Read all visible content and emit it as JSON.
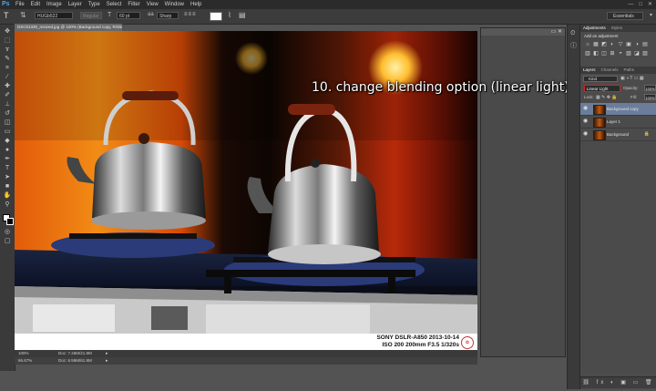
{
  "app": {
    "logo": "Ps",
    "menus": [
      "File",
      "Edit",
      "Image",
      "Layer",
      "Type",
      "Select",
      "Filter",
      "View",
      "Window",
      "Help"
    ],
    "window_controls": [
      "—",
      "□",
      "✕"
    ]
  },
  "options_bar": {
    "font_family": "HUGb522",
    "font_style": "Regular",
    "font_size": "60 pt",
    "antialias": "Sharp",
    "text_color": "#ffffff",
    "workspace": "Essentials"
  },
  "document": {
    "tab_title": "DSC01330_resized.jpg @ 100% (Background copy, RGB/16) *",
    "zoom_status": "100%",
    "doc_size": "Doc: 7.26M/21.8M",
    "bottom_zoom": "66.67%",
    "bottom_doc_size": "Doc: 6.59M/61.9M"
  },
  "photo_credit": {
    "line1": "SONY DSLR-A850 2013-10-14",
    "line2": "ISO 200 200mm F3.5 1/320s"
  },
  "annotation": "10. change blending option (linear light)",
  "adjustments_panel": {
    "tabs": [
      "Adjustments",
      "Styles"
    ],
    "add_label": "Add an adjustment",
    "icons": [
      "☼",
      "▦",
      "◩",
      "◐",
      "▽",
      "▣",
      "◑",
      "▤",
      "▥",
      "◧",
      "◫",
      "⊞",
      "◓",
      "▧",
      "◪",
      "▨"
    ]
  },
  "layers_panel": {
    "tabs": [
      "Layers",
      "Channels",
      "Paths"
    ],
    "kind_label": "Kind",
    "blend_mode": "Linear Light",
    "opacity_label": "Opacity:",
    "opacity_value": "100%",
    "lock_label": "Lock:",
    "fill_label": "Fill:",
    "fill_value": "100%",
    "layers": [
      {
        "name": "Background copy",
        "selected": true
      },
      {
        "name": "Layer 1",
        "selected": false
      },
      {
        "name": "Background",
        "selected": false
      }
    ]
  }
}
